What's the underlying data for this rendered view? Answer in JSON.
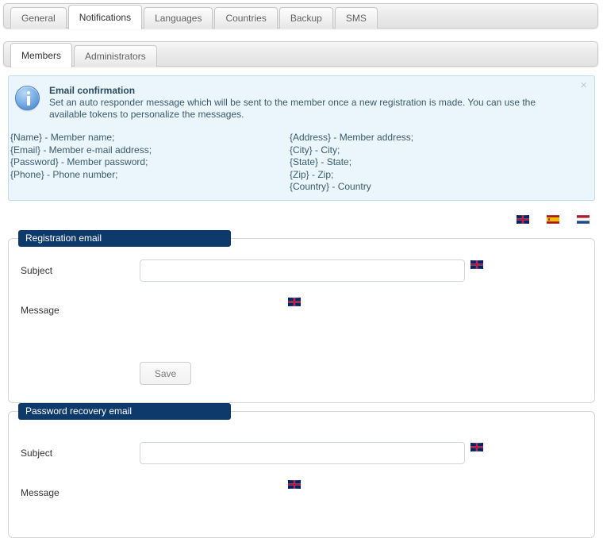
{
  "primary_tabs": [
    {
      "label": "General",
      "active": false
    },
    {
      "label": "Notifications",
      "active": true
    },
    {
      "label": "Languages",
      "active": false
    },
    {
      "label": "Countries",
      "active": false
    },
    {
      "label": "Backup",
      "active": false
    },
    {
      "label": "SMS",
      "active": false
    }
  ],
  "secondary_tabs": [
    {
      "label": "Members",
      "active": true
    },
    {
      "label": "Administrators",
      "active": false
    }
  ],
  "notice": {
    "icon": "info-icon",
    "close_label": "×",
    "title": "Email confirmation",
    "body": "Set an auto responder message which will be sent to the member once a new registration is made. You can use the available tokens to personalize the messages.",
    "tokens_left": [
      "{Name} - Member name;",
      "{Email} - Member e-mail address;",
      "{Password} - Member password;",
      "{Phone} - Phone number;"
    ],
    "tokens_right": [
      "{Address} - Member address;",
      "{City} - City;",
      "{State} - State;",
      "{Zip} - Zip;",
      "{Country} - Country"
    ],
    "bg_color": "#eaf5fc",
    "border_color": "#bcdff1"
  },
  "language_flags": [
    {
      "name": "flag-united-kingdom",
      "code": "en"
    },
    {
      "name": "flag-spain",
      "code": "es"
    },
    {
      "name": "flag-netherlands",
      "code": "nl"
    }
  ],
  "registration_panel": {
    "legend": "Registration email",
    "legend_color": "#0e3a6b",
    "subject_label": "Subject",
    "subject_value": "",
    "subject_placeholder": "",
    "subject_flag": "flag-united-kingdom",
    "message_label": "Message",
    "message_flag": "flag-united-kingdom",
    "save_label": "Save"
  },
  "recovery_panel": {
    "legend": "Password recovery email",
    "legend_color": "#0e3a6b",
    "subject_label": "Subject",
    "subject_value": "",
    "subject_placeholder": "",
    "subject_flag": "flag-united-kingdom",
    "message_label": "Message",
    "message_flag": "flag-united-kingdom"
  }
}
